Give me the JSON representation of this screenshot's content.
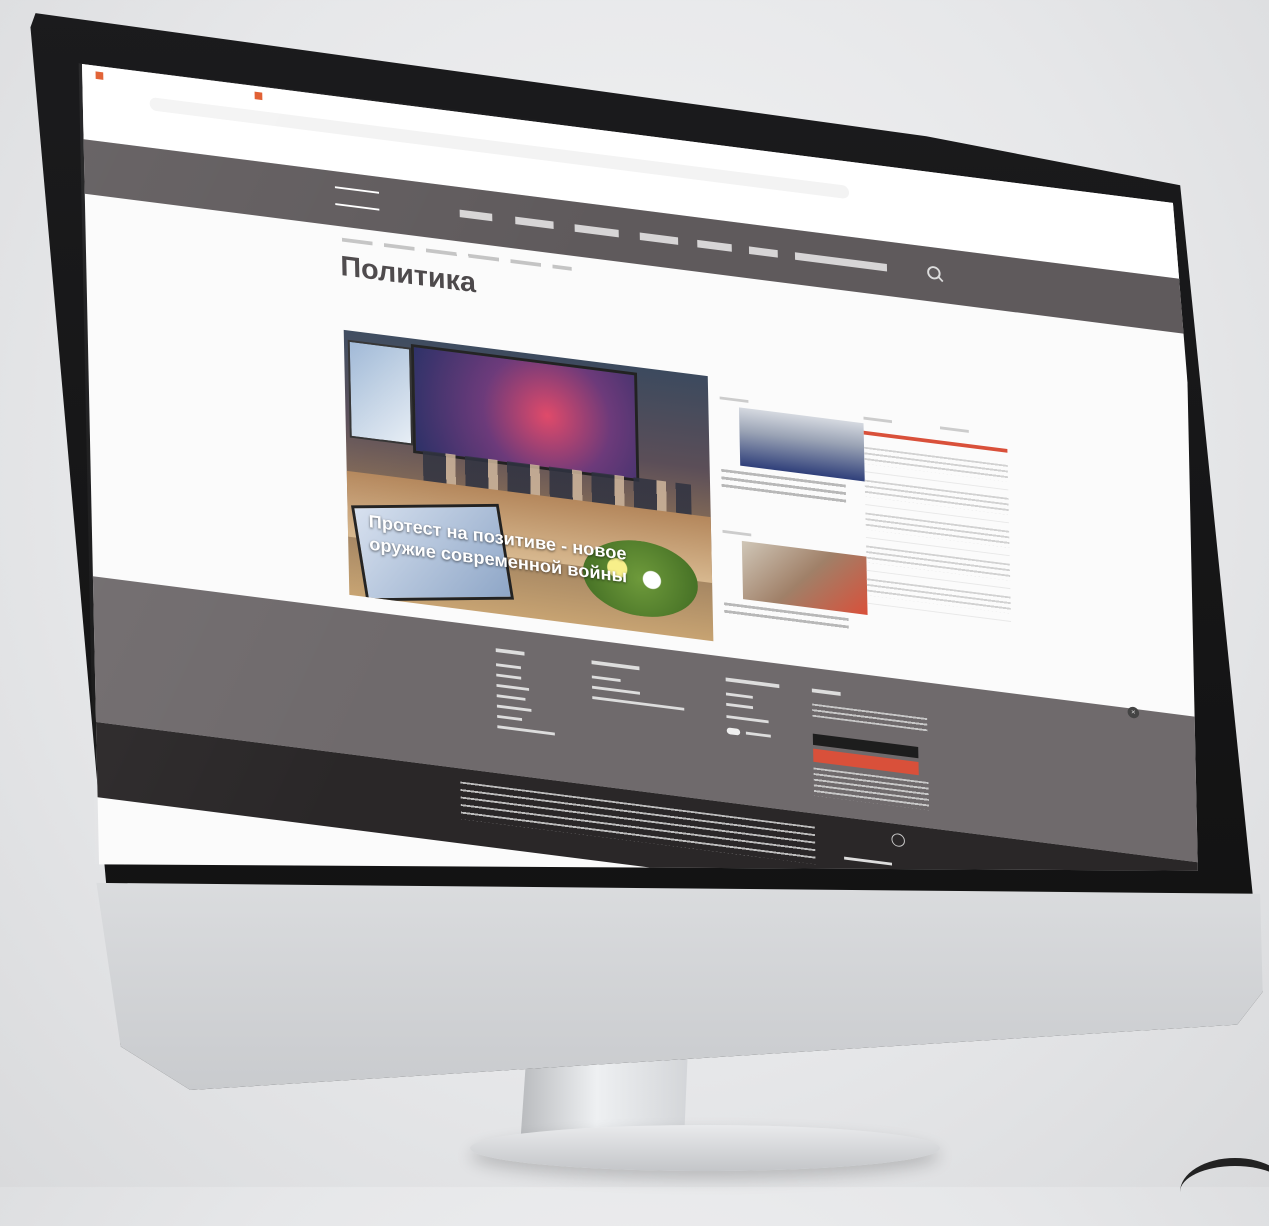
{
  "site": {
    "page_title": "Политика"
  },
  "hero": {
    "caption": "Протест на позитиве - новое оружие современной войны"
  }
}
